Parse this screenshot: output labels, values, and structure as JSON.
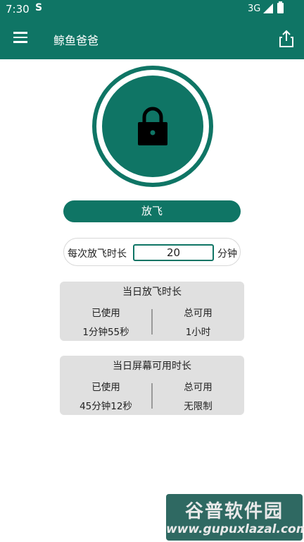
{
  "status_bar": {
    "time": "7:30",
    "sim_glyph": "S",
    "network": "3G"
  },
  "app_bar": {
    "title": "鲸鱼爸爸",
    "menu_icon": "hamburger-menu-icon",
    "share_icon": "share-icon"
  },
  "lock": {
    "icon": "lock-icon",
    "color": "#0f7565"
  },
  "fly_button": {
    "label": "放飞"
  },
  "duration": {
    "prefix": "每次放飞时长",
    "value": "20",
    "suffix": "分钟"
  },
  "daily_fly": {
    "title": "当日放飞时长",
    "used_label": "已使用",
    "used_value": "1分钟55秒",
    "total_label": "总可用",
    "total_value": "1小时"
  },
  "daily_screen": {
    "title": "当日屏幕可用时长",
    "used_label": "已使用",
    "used_value": "45分钟12秒",
    "total_label": "总可用",
    "total_value": "无限制"
  },
  "watermark": {
    "line1": "谷普软件园",
    "line2": "www.gupuxlazal.com"
  },
  "colors": {
    "primary": "#0f7565",
    "card_bg": "#e0e0e0"
  }
}
